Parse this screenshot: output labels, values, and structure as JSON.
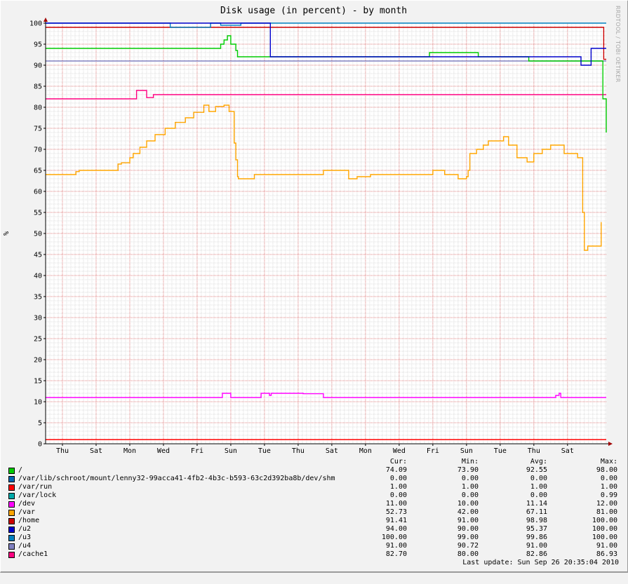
{
  "watermark": "RRDTOOL / TOBI OETIKER",
  "legend_headers": {
    "cur": "Cur:",
    "min": "Min:",
    "avg": "Avg:",
    "max": "Max:"
  },
  "last_update": "Last update: Sun Sep 26 20:35:04 2010",
  "legend": [
    {
      "name": "/",
      "color": "#00cc00",
      "cur": "74.09",
      "min": "73.90",
      "avg": "92.55",
      "max": "98.00"
    },
    {
      "name": "/var/lib/schroot/mount/lenny32-99acca41-4fb2-4b3c-b593-63c2d392ba8b/dev/shm",
      "color": "#0066b3",
      "cur": "0.00",
      "min": "0.00",
      "avg": "0.00",
      "max": "0.00"
    },
    {
      "name": "/var/run",
      "color": "#ff0000",
      "cur": "1.00",
      "min": "1.00",
      "avg": "1.00",
      "max": "1.00"
    },
    {
      "name": "/var/lock",
      "color": "#00aaaa",
      "cur": "0.00",
      "min": "0.00",
      "avg": "0.00",
      "max": "0.99"
    },
    {
      "name": "/dev",
      "color": "#ff00ff",
      "cur": "11.00",
      "min": "10.00",
      "avg": "11.14",
      "max": "12.00"
    },
    {
      "name": "/var",
      "color": "#ffa500",
      "cur": "52.73",
      "min": "42.00",
      "avg": "67.11",
      "max": "81.00"
    },
    {
      "name": "/home",
      "color": "#cc0000",
      "cur": "91.41",
      "min": "91.00",
      "avg": "98.98",
      "max": "100.00"
    },
    {
      "name": "/u2",
      "color": "#0000cc",
      "cur": "94.00",
      "min": "90.00",
      "avg": "95.37",
      "max": "100.00"
    },
    {
      "name": "/u3",
      "color": "#0080c0",
      "cur": "100.00",
      "min": "99.00",
      "avg": "99.86",
      "max": "100.00"
    },
    {
      "name": "/u4",
      "color": "#8080c0",
      "cur": "91.00",
      "min": "90.72",
      "avg": "91.00",
      "max": "91.00"
    },
    {
      "name": "/cache1",
      "color": "#ff0080",
      "cur": "82.70",
      "min": "80.00",
      "avg": "82.86",
      "max": "86.93"
    }
  ],
  "chart_data": {
    "type": "line",
    "title": "Disk usage (in percent) - by month",
    "ylabel": "%",
    "ylim": [
      0,
      100
    ],
    "yticks": [
      0,
      5,
      10,
      15,
      20,
      25,
      30,
      35,
      40,
      45,
      50,
      55,
      60,
      65,
      70,
      75,
      80,
      85,
      90,
      95,
      100
    ],
    "xlim": [
      0,
      33.3
    ],
    "xticks": [
      {
        "x": 1,
        "label": "Thu"
      },
      {
        "x": 3,
        "label": "Sat"
      },
      {
        "x": 5,
        "label": "Mon"
      },
      {
        "x": 7,
        "label": "Wed"
      },
      {
        "x": 9,
        "label": "Fri"
      },
      {
        "x": 11,
        "label": "Sun"
      },
      {
        "x": 13,
        "label": "Tue"
      },
      {
        "x": 15,
        "label": "Thu"
      },
      {
        "x": 17,
        "label": "Sat"
      },
      {
        "x": 19,
        "label": "Mon"
      },
      {
        "x": 21,
        "label": "Wed"
      },
      {
        "x": 23,
        "label": "Fri"
      },
      {
        "x": 25,
        "label": "Sun"
      },
      {
        "x": 27,
        "label": "Tue"
      },
      {
        "x": 29,
        "label": "Thu"
      },
      {
        "x": 31,
        "label": "Sat"
      }
    ],
    "grid": true,
    "series": [
      {
        "name": "/var/run",
        "color": "#ff0000",
        "x": [
          0,
          33.3
        ],
        "y": [
          1,
          1
        ]
      },
      {
        "name": "/dev",
        "color": "#ff00ff",
        "x": [
          0,
          10.4,
          10.5,
          10.9,
          11.0,
          12.7,
          12.8,
          13.2,
          13.3,
          13.4,
          15.2,
          15.3,
          16.4,
          16.5,
          30.2,
          30.3,
          30.5,
          30.6,
          33.3
        ],
        "y": [
          11,
          11,
          12,
          12,
          11,
          11,
          12,
          12,
          11.5,
          12,
          12,
          11.9,
          11.9,
          11,
          11,
          11.5,
          12,
          11,
          11
        ]
      },
      {
        "name": "/var",
        "color": "#ffa500",
        "x": [
          0,
          1.7,
          1.8,
          2.0,
          4.1,
          4.3,
          4.5,
          5.0,
          5.2,
          5.6,
          6.0,
          6.5,
          7.1,
          7.7,
          8.3,
          8.8,
          9.4,
          9.7,
          10.1,
          10.6,
          10.9,
          11.2,
          11.3,
          11.4,
          11.45,
          11.8,
          12.4,
          12.8,
          13.2,
          16.5,
          17.8,
          18.0,
          18.5,
          19.3,
          19.6,
          20.1,
          20.7,
          22.5,
          23.0,
          23.5,
          23.7,
          24.5,
          25.0,
          25.1,
          25.2,
          25.6,
          26.0,
          26.3,
          27.2,
          27.5,
          28.0,
          28.6,
          29.0,
          29.5,
          30.0,
          30.8,
          31.1,
          31.4,
          31.6,
          31.9,
          32.0,
          32.2,
          32.7,
          33.0
        ],
        "y": [
          64,
          64,
          64.7,
          65,
          65,
          66.5,
          66.8,
          68,
          69,
          70.5,
          72,
          73.5,
          75,
          76.4,
          77.5,
          78.8,
          80.5,
          79,
          80.2,
          80.5,
          79,
          71.5,
          67.5,
          63.5,
          63,
          63,
          64,
          64,
          64,
          65,
          65,
          63,
          63.5,
          64,
          64,
          64,
          64,
          64,
          65,
          65,
          64,
          63,
          63.5,
          65,
          69,
          70,
          71,
          72,
          73,
          71,
          68,
          67,
          69,
          70,
          71,
          69,
          69,
          69,
          68,
          55,
          46,
          47,
          47,
          52.7
        ]
      },
      {
        "name": "/cache1",
        "color": "#ff0080",
        "x": [
          0,
          5.3,
          5.4,
          5.8,
          6.0,
          6.3,
          6.4,
          33.3
        ],
        "y": [
          82,
          82,
          84,
          84,
          82.3,
          82.3,
          83,
          83
        ]
      },
      {
        "name": "/u4",
        "color": "#8080c0",
        "x": [
          0,
          33.3
        ],
        "y": [
          91,
          91
        ]
      },
      {
        "name": "/",
        "color": "#00cc00",
        "x": [
          0,
          10.3,
          10.4,
          10.6,
          10.8,
          11.0,
          11.1,
          11.3,
          11.4,
          20.2,
          22.7,
          22.8,
          25.6,
          25.7,
          27.5,
          27.6,
          28.6,
          28.7,
          33.0,
          33.1,
          33.3
        ],
        "y": [
          94,
          94,
          95,
          96,
          97,
          95,
          95,
          93.5,
          92,
          92,
          92,
          93,
          93,
          92,
          92,
          92,
          92,
          91,
          91,
          82,
          74
        ]
      },
      {
        "name": "/home",
        "color": "#cc0000",
        "x": [
          0,
          33.1,
          33.15,
          33.3
        ],
        "y": [
          99,
          99,
          91.4,
          91.4
        ]
      },
      {
        "name": "/u3",
        "color": "#0080c0",
        "x": [
          0,
          7.3,
          7.4,
          9.7,
          9.8,
          10.3,
          10.4,
          11.5,
          11.6,
          12.4,
          12.5,
          33.3
        ],
        "y": [
          100,
          100,
          99,
          99,
          100,
          100,
          99.5,
          99.5,
          100,
          100,
          100,
          100
        ]
      },
      {
        "name": "/u2",
        "color": "#0000cc",
        "x": [
          0,
          12.9,
          13.3,
          13.35,
          31.7,
          31.8,
          32.3,
          32.4,
          33.3
        ],
        "y": [
          100,
          100,
          100,
          92,
          92,
          90,
          90,
          94,
          94
        ]
      }
    ]
  }
}
